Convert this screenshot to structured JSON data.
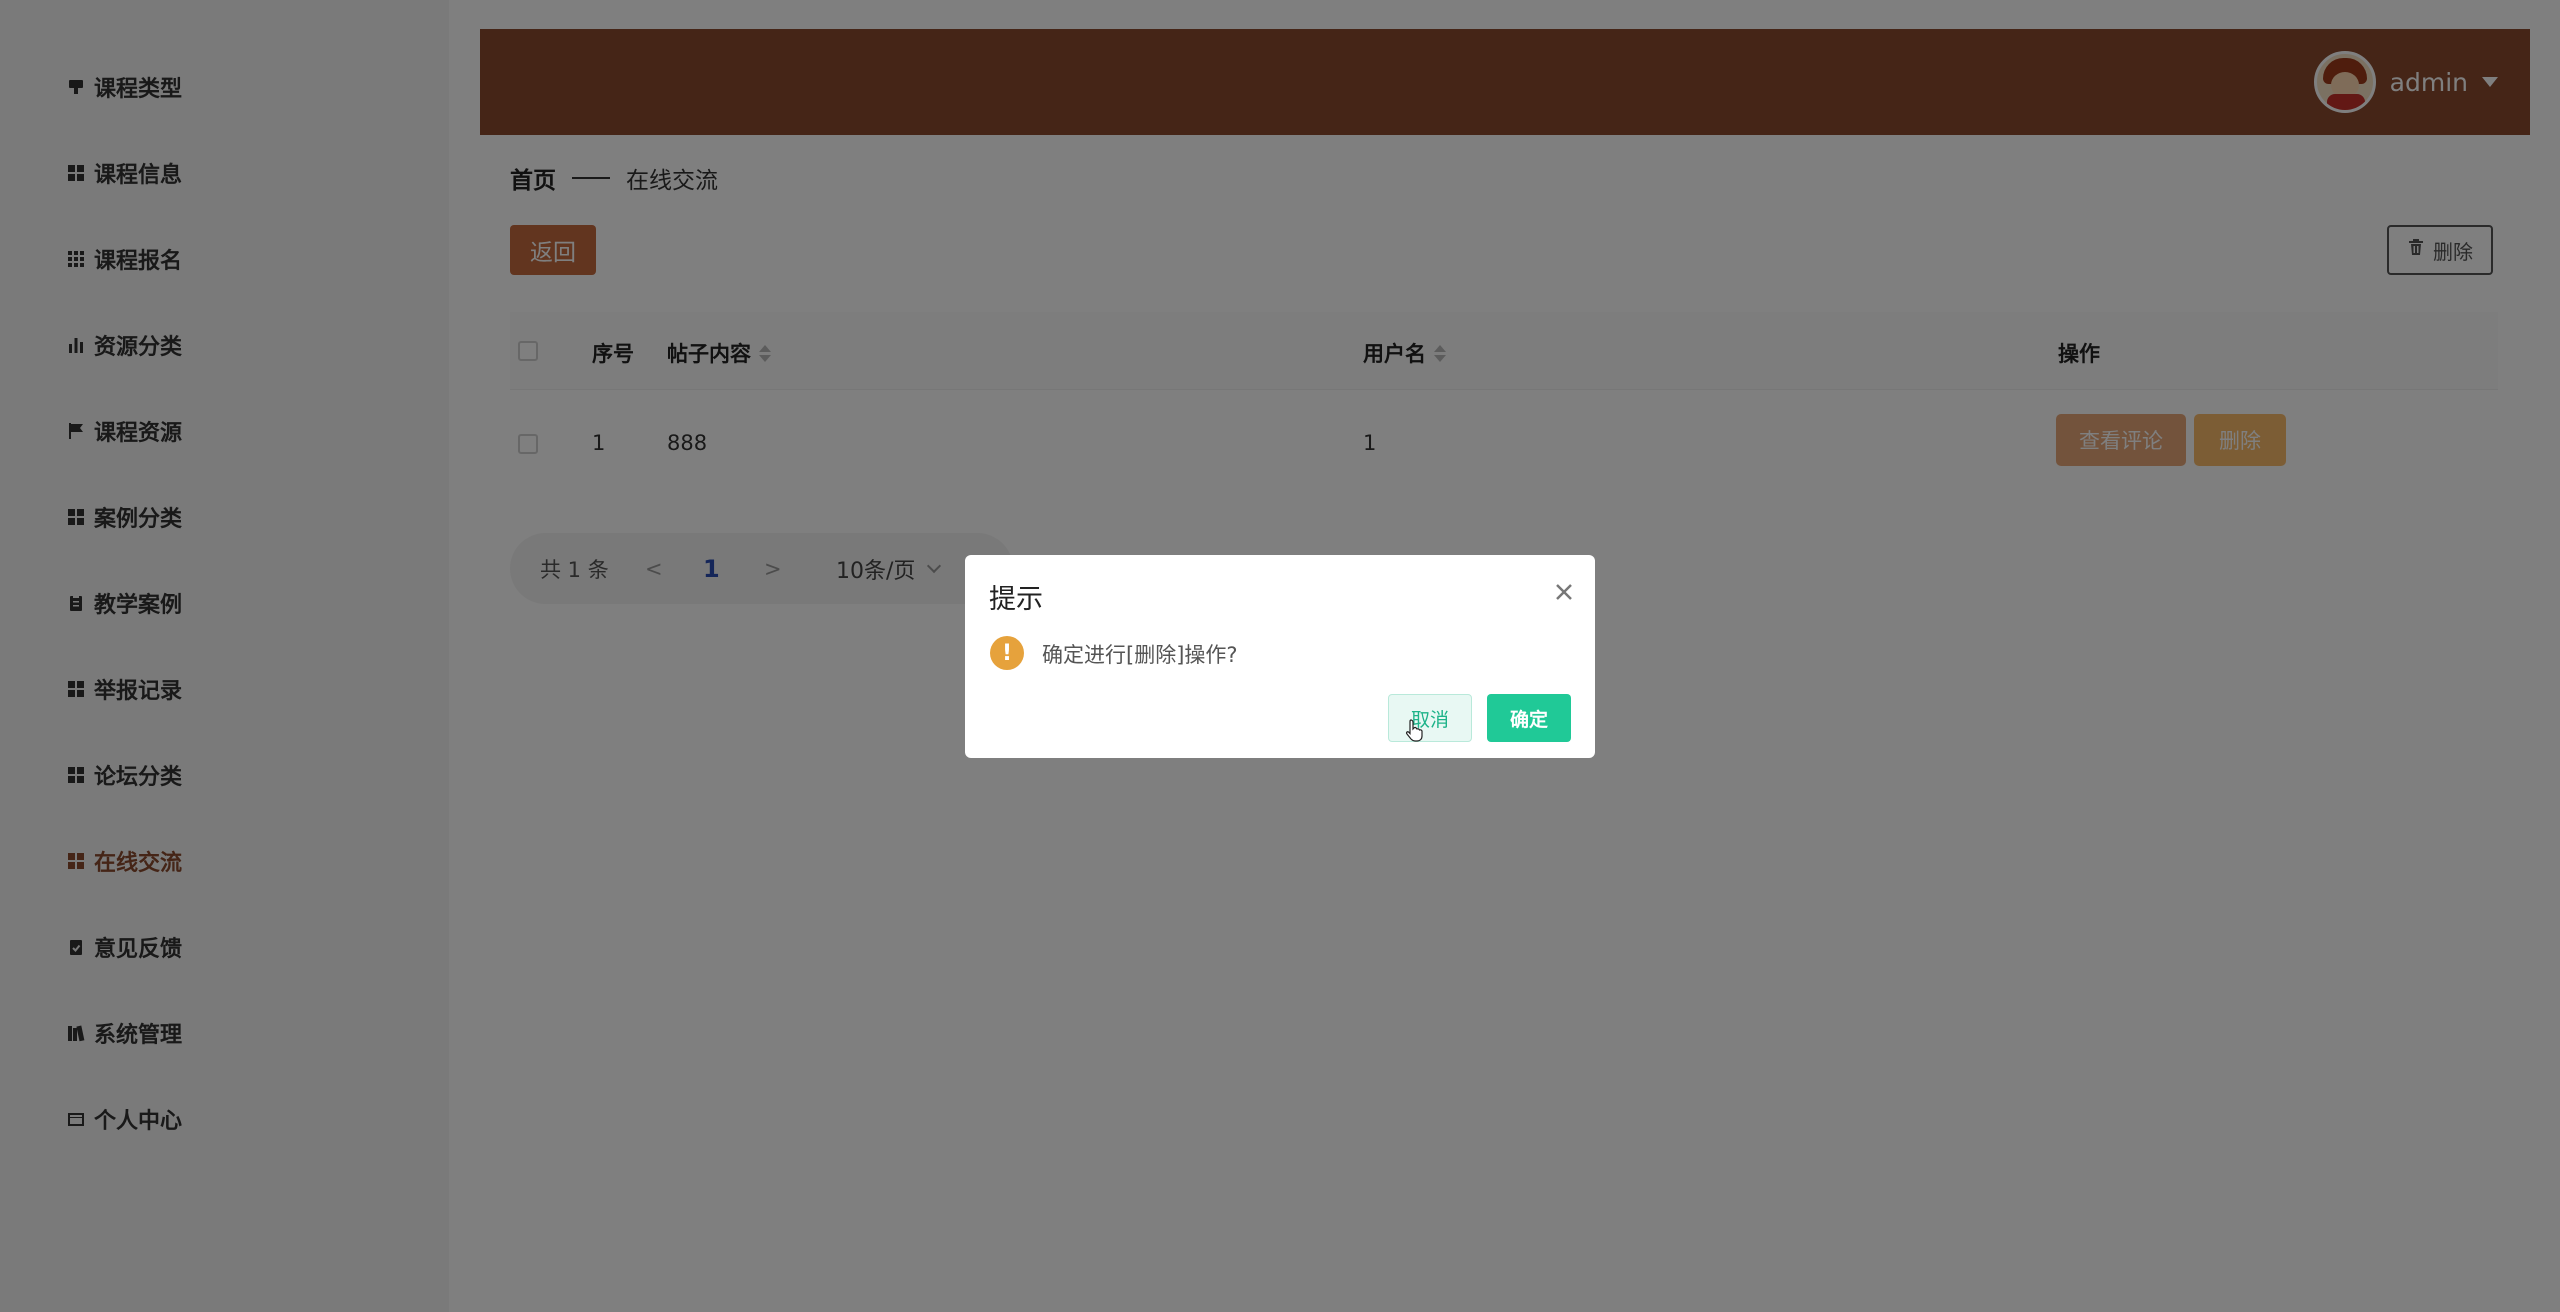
{
  "sidebar": {
    "items": [
      {
        "label": "课程类型",
        "icon": "chalkboard-icon"
      },
      {
        "label": "课程信息",
        "icon": "grid-icon"
      },
      {
        "label": "课程报名",
        "icon": "grid-dots-icon"
      },
      {
        "label": "资源分类",
        "icon": "bar-chart-icon"
      },
      {
        "label": "课程资源",
        "icon": "flag-icon"
      },
      {
        "label": "案例分类",
        "icon": "grid-icon"
      },
      {
        "label": "教学案例",
        "icon": "clipboard-icon"
      },
      {
        "label": "举报记录",
        "icon": "grid-icon"
      },
      {
        "label": "论坛分类",
        "icon": "grid-icon"
      },
      {
        "label": "在线交流",
        "icon": "grid-icon"
      },
      {
        "label": "意见反馈",
        "icon": "checklist-icon"
      },
      {
        "label": "系统管理",
        "icon": "books-icon"
      },
      {
        "label": "个人中心",
        "icon": "wallet-icon"
      }
    ],
    "active_index": 9
  },
  "header": {
    "username": "admin",
    "bg_color": "#8a4a2e"
  },
  "breadcrumb": {
    "home": "首页",
    "current": "在线交流"
  },
  "toolbar": {
    "back_label": "返回",
    "delete_label": "删除"
  },
  "table": {
    "columns": {
      "index": "序号",
      "content": "帖子内容",
      "username": "用户名",
      "actions": "操作"
    },
    "rows": [
      {
        "index": "1",
        "content": "888",
        "username": "1",
        "view_label": "查看评论",
        "delete_label": "删除"
      }
    ]
  },
  "pagination": {
    "total": "共 1 条",
    "prev": "<",
    "page": "1",
    "next": ">",
    "page_size": "10条/页"
  },
  "dialog": {
    "title": "提示",
    "message": "确定进行[删除]操作?",
    "cancel_label": "取消",
    "confirm_label": "确定",
    "accent_color": "#20c997",
    "warning_color": "#e6a23c"
  }
}
